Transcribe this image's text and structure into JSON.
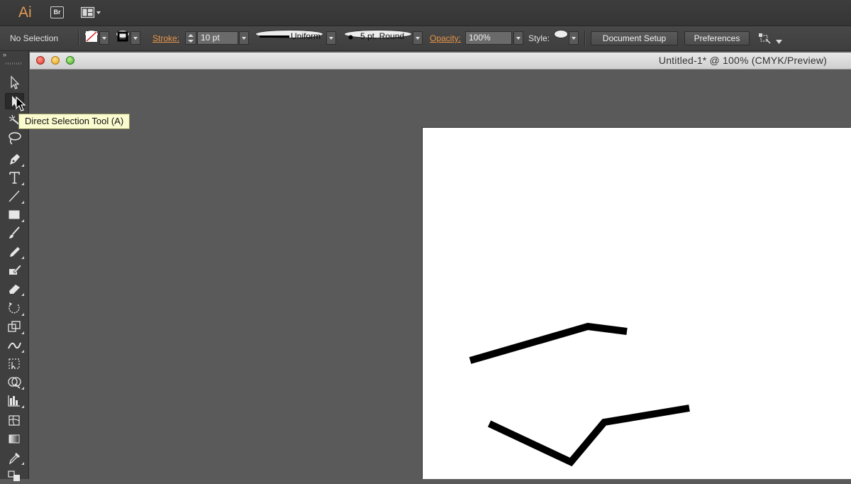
{
  "app": {
    "logo_text": "Ai",
    "bridge_label": "Br"
  },
  "control_bar": {
    "selection_status": "No Selection",
    "stroke_label": "Stroke:",
    "stroke_weight": "10 pt",
    "variable_width_profile": "Uniform",
    "brush_definition": "5 pt. Round",
    "opacity_label": "Opacity:",
    "opacity_value": "100%",
    "style_label": "Style:",
    "document_setup_label": "Document Setup",
    "preferences_label": "Preferences",
    "accent_color": "#e8964a"
  },
  "tools_panel": {
    "collapse_glyph": "»",
    "tooltip": "Direct Selection Tool (A)",
    "active_tool": "direct-selection-tool"
  },
  "document": {
    "title": "Untitled-1* @ 100% (CMYK/Preview)",
    "window_controls": [
      "close",
      "minimize",
      "zoom"
    ]
  }
}
